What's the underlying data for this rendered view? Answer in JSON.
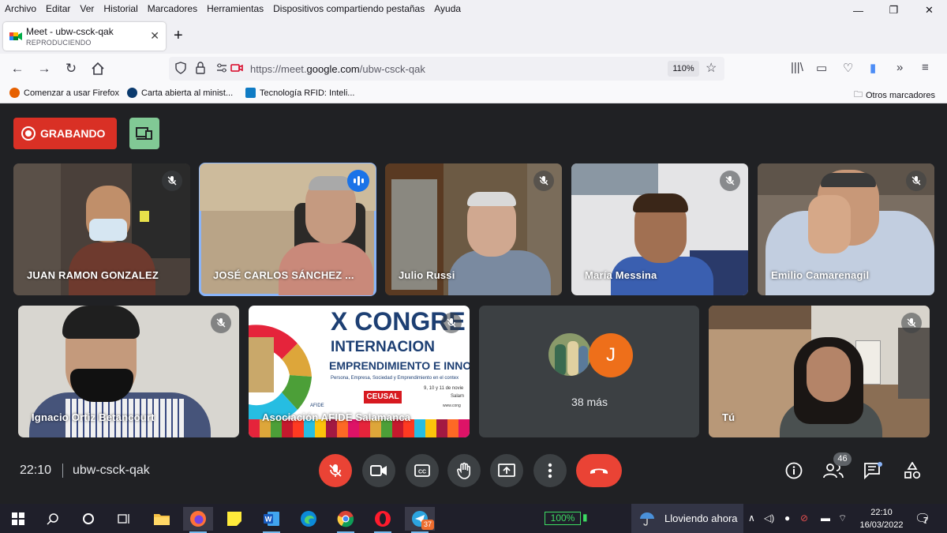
{
  "menu": [
    "Archivo",
    "Editar",
    "Ver",
    "Historial",
    "Marcadores",
    "Herramientas",
    "Dispositivos compartiendo pestañas",
    "Ayuda"
  ],
  "window_controls": {
    "minimize": "—",
    "restore": "❐",
    "close": "✕"
  },
  "tab": {
    "title": "Meet - ubw-csck-qak",
    "subtitle": "REPRODUCIENDO",
    "close": "✕",
    "new_tab": "+"
  },
  "nav": {
    "url_prefix": "https://meet.",
    "url_domain": "google.com",
    "url_path": "/ubw-csck-qak",
    "zoom": "110%"
  },
  "bookmarks": [
    {
      "label": "Comenzar a usar Firefox",
      "color": "#e66000"
    },
    {
      "label": "Carta abierta al minist...",
      "color": "#0b3a6e"
    },
    {
      "label": "Tecnología RFID: Inteli...",
      "color": "#0f7bc4"
    }
  ],
  "other_bookmarks": "Otros marcadores",
  "meet": {
    "recording_label": "GRABANDO",
    "participants_top": [
      {
        "name": "JUAN RAMON GONZALEZ"
      },
      {
        "name": "JOSÉ CARLOS SÁNCHEZ ..."
      },
      {
        "name": "Julio Russi"
      },
      {
        "name": "María Messina"
      },
      {
        "name": "Emilio Camarenagil"
      }
    ],
    "participants_bottom": [
      {
        "name": "Ignacio Ortiz Betancourt"
      },
      {
        "name": "Asociación AFIDE Salamanca"
      },
      {
        "name": "Tú"
      }
    ],
    "presentation": {
      "line1": "X CONGRE",
      "line2": "INTERNACION",
      "line3": "EMPRENDIMIENTO E INNOV",
      "line4": "Persona, Empresa, Sociedad y Emprendimiento en el contex",
      "line5": "9, 10 y 11 de novie",
      "line6": "Salam",
      "logo1": "AFIDE",
      "logo2": "CEUSAL",
      "web": "www.cong"
    },
    "more": {
      "avatar_letter": "J",
      "label": "38 más"
    },
    "time": "22:10",
    "meeting_code": "ubw-csck-qak",
    "participant_count": "46"
  },
  "taskbar": {
    "battery": "100%",
    "weather": "Lloviendo ahora",
    "time": "22:10",
    "date": "16/03/2022",
    "telegram_badge": "37",
    "notification_count": "7"
  },
  "colors": {
    "meet_bg": "#202124",
    "tile_bg": "#3c4043",
    "red": "#ea4335",
    "speaking": "#1a73e8"
  }
}
